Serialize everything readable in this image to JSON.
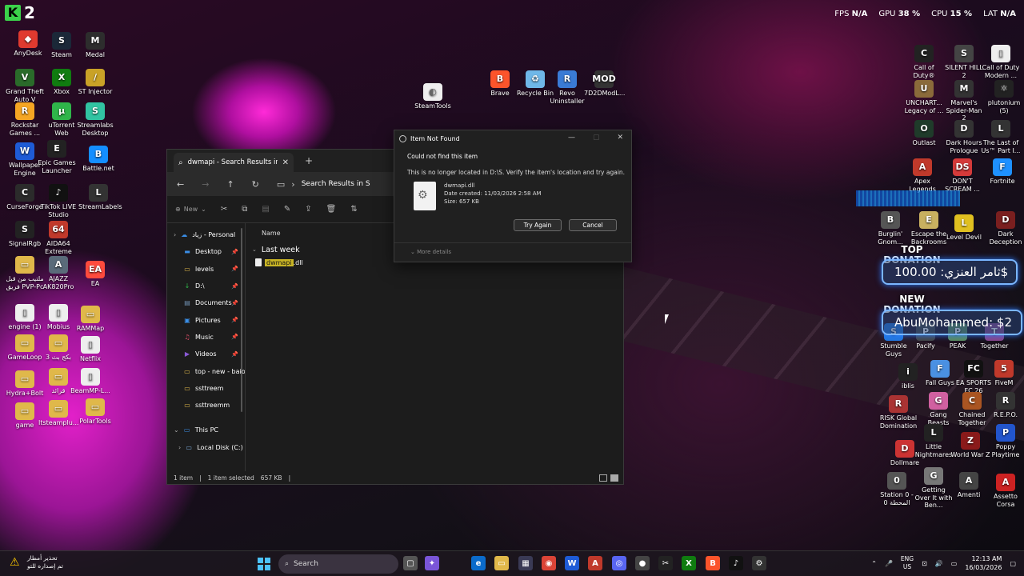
{
  "overlay": {
    "counter": "2",
    "fps_label": "FPS",
    "fps_value": "N/A",
    "gpu_label": "GPU",
    "gpu_value": "38 %",
    "cpu_label": "CPU",
    "cpu_value": "15 %",
    "lat_label": "LAT",
    "lat_value": "N/A"
  },
  "desktop_left": [
    {
      "label": "AnyDesk",
      "color": "#e03a2f",
      "glyph": "◆"
    },
    {
      "label": "Steam",
      "color": "#1b2838",
      "glyph": "S"
    },
    {
      "label": "Medal",
      "color": "#2d2d2d",
      "glyph": "M"
    },
    {
      "label": "Grand Theft Auto V",
      "color": "#2a6b2a",
      "glyph": "V"
    },
    {
      "label": "Xbox",
      "color": "#107c10",
      "glyph": "X"
    },
    {
      "label": "ST Injector",
      "color": "#c9a227",
      "glyph": "/"
    },
    {
      "label": "Rockstar Games ...",
      "color": "#f5a623",
      "glyph": "R"
    },
    {
      "label": "uTorrent Web",
      "color": "#2fb54a",
      "glyph": "μ"
    },
    {
      "label": "Streamlabs Desktop",
      "color": "#31c3a2",
      "glyph": "S"
    },
    {
      "label": "Wallpaper Engine",
      "color": "#1e5bd6",
      "glyph": "W"
    },
    {
      "label": "Epic Games Launcher",
      "color": "#222222",
      "glyph": "E"
    },
    {
      "label": "Battle.net",
      "color": "#148eff",
      "glyph": "B"
    },
    {
      "label": "CurseForge",
      "color": "#2b2b2b",
      "glyph": "C"
    },
    {
      "label": "TikTok LIVE Studio",
      "color": "#111111",
      "glyph": "♪"
    },
    {
      "label": "StreamLabels",
      "color": "#333333",
      "glyph": "L"
    },
    {
      "label": "SignalRgb",
      "color": "#222222",
      "glyph": "S"
    },
    {
      "label": "AIDA64 Extreme",
      "color": "#c0392b",
      "glyph": "64"
    },
    {
      "label": "ملتيب من قبل فريق PVP-Pc",
      "color": "#e0b84a",
      "glyph": "▭"
    },
    {
      "label": "AJAZZ AK820Pro",
      "color": "#5a6b7a",
      "glyph": "A"
    },
    {
      "label": "EA",
      "color": "#ff4a3d",
      "glyph": "EA"
    },
    {
      "label": "engine (1)",
      "color": "#eeeeee",
      "glyph": "▯"
    },
    {
      "label": "Mobius",
      "color": "#eeeeee",
      "glyph": "▯"
    },
    {
      "label": "RAMMap",
      "color": "#e0b84a",
      "glyph": "▭"
    },
    {
      "label": "GameLoop",
      "color": "#e0b84a",
      "glyph": "▭"
    },
    {
      "label": "بكج بث 3",
      "color": "#e0b84a",
      "glyph": "▭"
    },
    {
      "label": "Netflix",
      "color": "#eeeeee",
      "glyph": "▯"
    },
    {
      "label": "Hydra+Bolt",
      "color": "#e0b84a",
      "glyph": "▭"
    },
    {
      "label": "قرائد",
      "color": "#e0b84a",
      "glyph": "▭"
    },
    {
      "label": "BeamMP-L...",
      "color": "#eeeeee",
      "glyph": "▯"
    },
    {
      "label": "game",
      "color": "#e0b84a",
      "glyph": "▭"
    },
    {
      "label": "Itsteamplu...",
      "color": "#e0b84a",
      "glyph": "▭"
    },
    {
      "label": "PolarTools",
      "color": "#e0b84a",
      "glyph": "▭"
    }
  ],
  "desktop_mid": [
    {
      "label": "SteamTools",
      "color": "#eeeeee",
      "glyph": "◐"
    },
    {
      "label": "Brave",
      "color": "#fb542b",
      "glyph": "B"
    },
    {
      "label": "Recycle Bin",
      "color": "#6fb7e8",
      "glyph": "♻"
    },
    {
      "label": "Revo Uninstaller",
      "color": "#3a7bd5",
      "glyph": "R"
    },
    {
      "label": "7D2DModL...",
      "color": "#333333",
      "glyph": "MOD"
    }
  ],
  "desktop_right": [
    {
      "label": "Call of Duty®",
      "color": "#222222",
      "glyph": "C"
    },
    {
      "label": "SILENT HILL 2",
      "color": "#444444",
      "glyph": "S"
    },
    {
      "label": "Call of Duty Modern ...",
      "color": "#eeeeee",
      "glyph": "▯"
    },
    {
      "label": "UNCHART... Legacy of ...",
      "color": "#8a6a3a",
      "glyph": "U"
    },
    {
      "label": "Marvel's Spider-Man 2",
      "color": "#333333",
      "glyph": "M"
    },
    {
      "label": "plutonium (5)",
      "color": "#222222",
      "glyph": "⚛"
    },
    {
      "label": "Outlast",
      "color": "#1f3b2a",
      "glyph": "O"
    },
    {
      "label": "Dark Hours Prologue",
      "color": "#333333",
      "glyph": "D"
    },
    {
      "label": "The Last of Us™ Part I...",
      "color": "#333333",
      "glyph": "L"
    },
    {
      "label": "Apex Legends",
      "color": "#c0392b",
      "glyph": "A"
    },
    {
      "label": "DON'T SCREAM ...",
      "color": "#d43a3a",
      "glyph": "DS"
    },
    {
      "label": "Fortnite",
      "color": "#1e90ff",
      "glyph": "F"
    },
    {
      "label": "Burglin' Gnom...",
      "color": "#555555",
      "glyph": "B"
    },
    {
      "label": "Escape the Backrooms",
      "color": "#c8b060",
      "glyph": "E"
    },
    {
      "label": "Level Devil",
      "color": "#e0c020",
      "glyph": "L"
    },
    {
      "label": "Dark Deception",
      "color": "#7a1f1f",
      "glyph": "D"
    },
    {
      "label": "Stumble Guys",
      "color": "#2277dd",
      "glyph": "S"
    },
    {
      "label": "Pacify",
      "color": "#444444",
      "glyph": "P"
    },
    {
      "label": "PEAK",
      "color": "#5a8a5a",
      "glyph": "P"
    },
    {
      "label": "Together",
      "color": "#884488",
      "glyph": "T"
    },
    {
      "label": "iblis",
      "color": "#222222",
      "glyph": "i"
    },
    {
      "label": "Fall Guys",
      "color": "#4a90e2",
      "glyph": "F"
    },
    {
      "label": "EA SPORTS FC 26",
      "color": "#111111",
      "glyph": "FC"
    },
    {
      "label": "FiveM",
      "color": "#c0392b",
      "glyph": "5"
    },
    {
      "label": "RISK Global Domination",
      "color": "#a33",
      "glyph": "R"
    },
    {
      "label": "Gang Beasts",
      "color": "#d060a0",
      "glyph": "G"
    },
    {
      "label": "Chained Together",
      "color": "#aa5522",
      "glyph": "C"
    },
    {
      "label": "R.E.P.O.",
      "color": "#333333",
      "glyph": "R"
    },
    {
      "label": "Little Nightmares",
      "color": "#222222",
      "glyph": "L"
    },
    {
      "label": "World War Z",
      "color": "#8a1a1a",
      "glyph": "Z"
    },
    {
      "label": "Poppy Playtime",
      "color": "#2255cc",
      "glyph": "P"
    },
    {
      "label": "Dollmare",
      "color": "#cc3333",
      "glyph": "D"
    },
    {
      "label": "Station 0 - المحطة 0",
      "color": "#555555",
      "glyph": "0"
    },
    {
      "label": "Getting Over It with Ben...",
      "color": "#777777",
      "glyph": "G"
    },
    {
      "label": "Amenti",
      "color": "#444444",
      "glyph": "A"
    },
    {
      "label": "Assetto Corsa",
      "color": "#cc2222",
      "glyph": "A"
    }
  ],
  "donations": {
    "top_label": "TOP DONATION",
    "top_text": "ثامر العنزي: 100.00$",
    "new_label": "NEW DONATION",
    "new_text": "AbuMohammed: $2"
  },
  "explorer": {
    "tab_title": "dwmapi - Search Results in S",
    "address": "Search Results in S",
    "new_label": "New",
    "column_name": "Name",
    "group_label": "Last week",
    "file_name_highlight": "dwmapi",
    "file_name_ext": ".dll",
    "nav": [
      {
        "label": "زياد - Personal",
        "icon": "cloud",
        "color": "#3a8ee6",
        "pin": false,
        "top": true
      },
      {
        "label": "Desktop",
        "icon": "desktop",
        "color": "#3a8ee6",
        "pin": true
      },
      {
        "label": "levels",
        "icon": "folder",
        "color": "#e0b84a",
        "pin": true
      },
      {
        "label": "D:\\",
        "icon": "download",
        "color": "#2fb54a",
        "pin": true
      },
      {
        "label": "Documents",
        "icon": "docs",
        "color": "#6f8fb0",
        "pin": true
      },
      {
        "label": "Pictures",
        "icon": "pictures",
        "color": "#3a8ee6",
        "pin": true
      },
      {
        "label": "Music",
        "icon": "music",
        "color": "#e0506a",
        "pin": true
      },
      {
        "label": "Videos",
        "icon": "videos",
        "color": "#8a5ad6",
        "pin": true
      },
      {
        "label": "top - new - baio",
        "icon": "folder",
        "color": "#e0b84a",
        "pin": false
      },
      {
        "label": "ssttreem",
        "icon": "folder",
        "color": "#e0b84a",
        "pin": false
      },
      {
        "label": "ssttreemm",
        "icon": "folder",
        "color": "#e0b84a",
        "pin": false
      }
    ],
    "this_pc": "This PC",
    "local_disk": "Local Disk (C:)",
    "status_count": "1 item",
    "status_selected": "1 item selected",
    "status_size": "657 KB"
  },
  "dialog": {
    "title": "Item Not Found",
    "heading": "Could not find this item",
    "message": "This is no longer located in D:\\S. Verify the item's location and try again.",
    "file_name": "dwmapi.dll",
    "date_created": "Date created: 11/03/2026 2:58 AM",
    "size": "Size: 657 KB",
    "try_again": "Try Again",
    "cancel": "Cancel",
    "more_details": "More details"
  },
  "taskbar": {
    "weather_line1": "تحذير أمطار",
    "weather_line2": "تم إصداره للتو",
    "search": "Search",
    "lang1": "ENG",
    "lang2": "US",
    "time": "12:13 AM",
    "date": "16/03/2026"
  }
}
